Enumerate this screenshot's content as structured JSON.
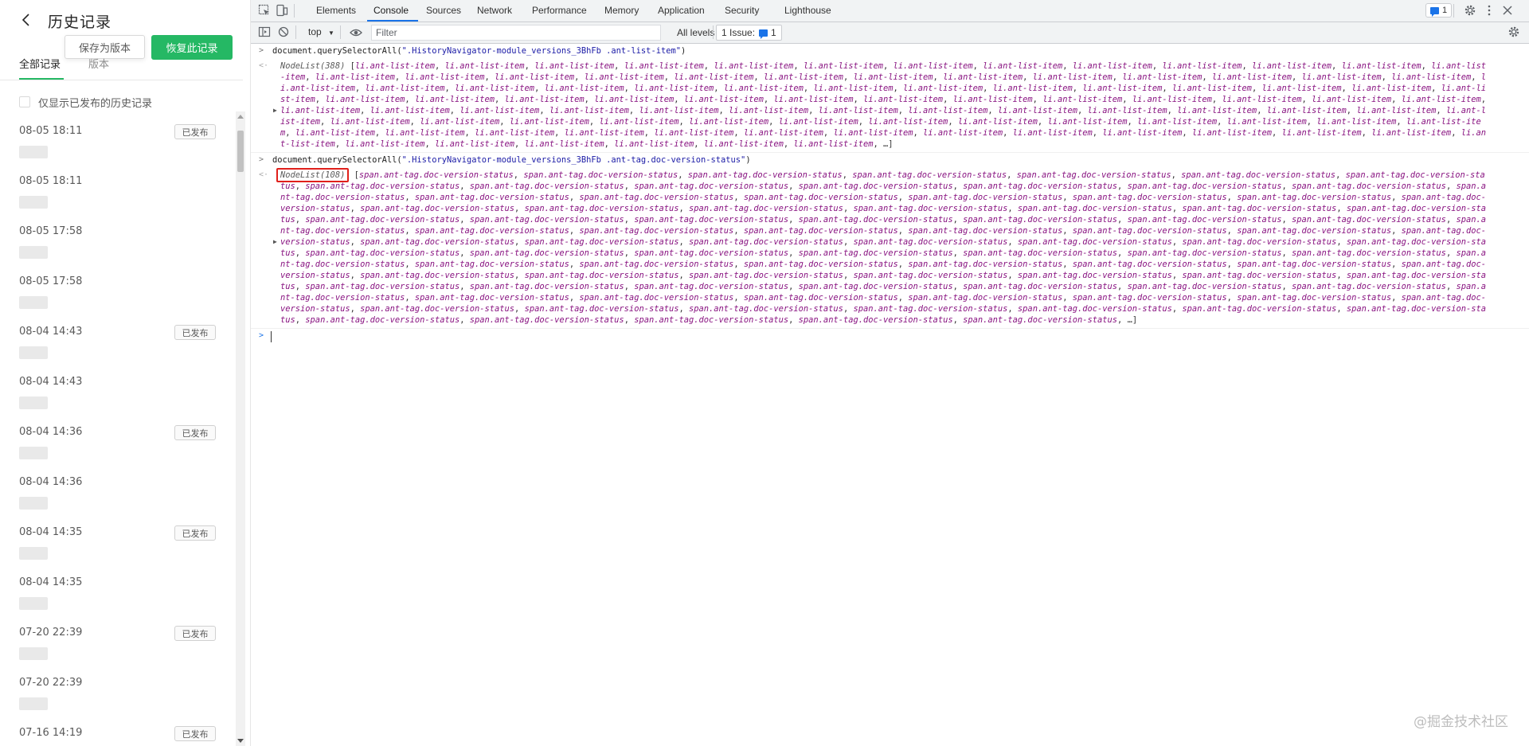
{
  "sidebar": {
    "title": "历史记录",
    "save_version_label": "保存为版本",
    "restore_label": "恢复此记录",
    "tabs": [
      "全部记录",
      "版本"
    ],
    "filter_label": "仅显示已发布的历史记录",
    "items": [
      {
        "time": "08-05 18:11",
        "badge": "已发布"
      },
      {
        "time": "08-05 18:11",
        "badge": ""
      },
      {
        "time": "08-05 17:58",
        "badge": ""
      },
      {
        "time": "08-05 17:58",
        "badge": ""
      },
      {
        "time": "08-04 14:43",
        "badge": "已发布"
      },
      {
        "time": "08-04 14:43",
        "badge": ""
      },
      {
        "time": "08-04 14:36",
        "badge": "已发布"
      },
      {
        "time": "08-04 14:36",
        "badge": ""
      },
      {
        "time": "08-04 14:35",
        "badge": "已发布"
      },
      {
        "time": "08-04 14:35",
        "badge": ""
      },
      {
        "time": "07-20 22:39",
        "badge": "已发布"
      },
      {
        "time": "07-20 22:39",
        "badge": ""
      },
      {
        "time": "07-16 14:19",
        "badge": "已发布"
      }
    ]
  },
  "devtools": {
    "tabs": [
      "Elements",
      "Console",
      "Sources",
      "Network",
      "Performance",
      "Memory",
      "Application",
      "Security",
      "Lighthouse"
    ],
    "active_tab": "Console",
    "messages_count": "1",
    "toolbar": {
      "context": "top",
      "filter_placeholder": "Filter",
      "levels": "All levels",
      "issues_label": "1 Issue:",
      "issues_count": "1"
    },
    "console": {
      "cmd1": "document.querySelectorAll(\".HistoryNavigator-module_versions_3BhFb .ant-list-item\")",
      "res1_label": "NodeList(388)",
      "res1_item": "li.ant-list-item",
      "res1_count": 100,
      "cmd2": "document.querySelectorAll(\".HistoryNavigator-module_versions_3BhFb .ant-tag.doc-version-status\")",
      "res2_label": "NodeList(108)",
      "res2_item": "span.ant-tag.doc-version-status",
      "res2_count": 100,
      "ellipsis": "…"
    }
  },
  "watermark": "@掘金技术社区",
  "colors": {
    "accent_green": "#25b864",
    "devtools_blue": "#1a73e8",
    "highlight_red": "#e0201b",
    "string_blue": "#1a1aa6",
    "item_purple": "#881280"
  }
}
